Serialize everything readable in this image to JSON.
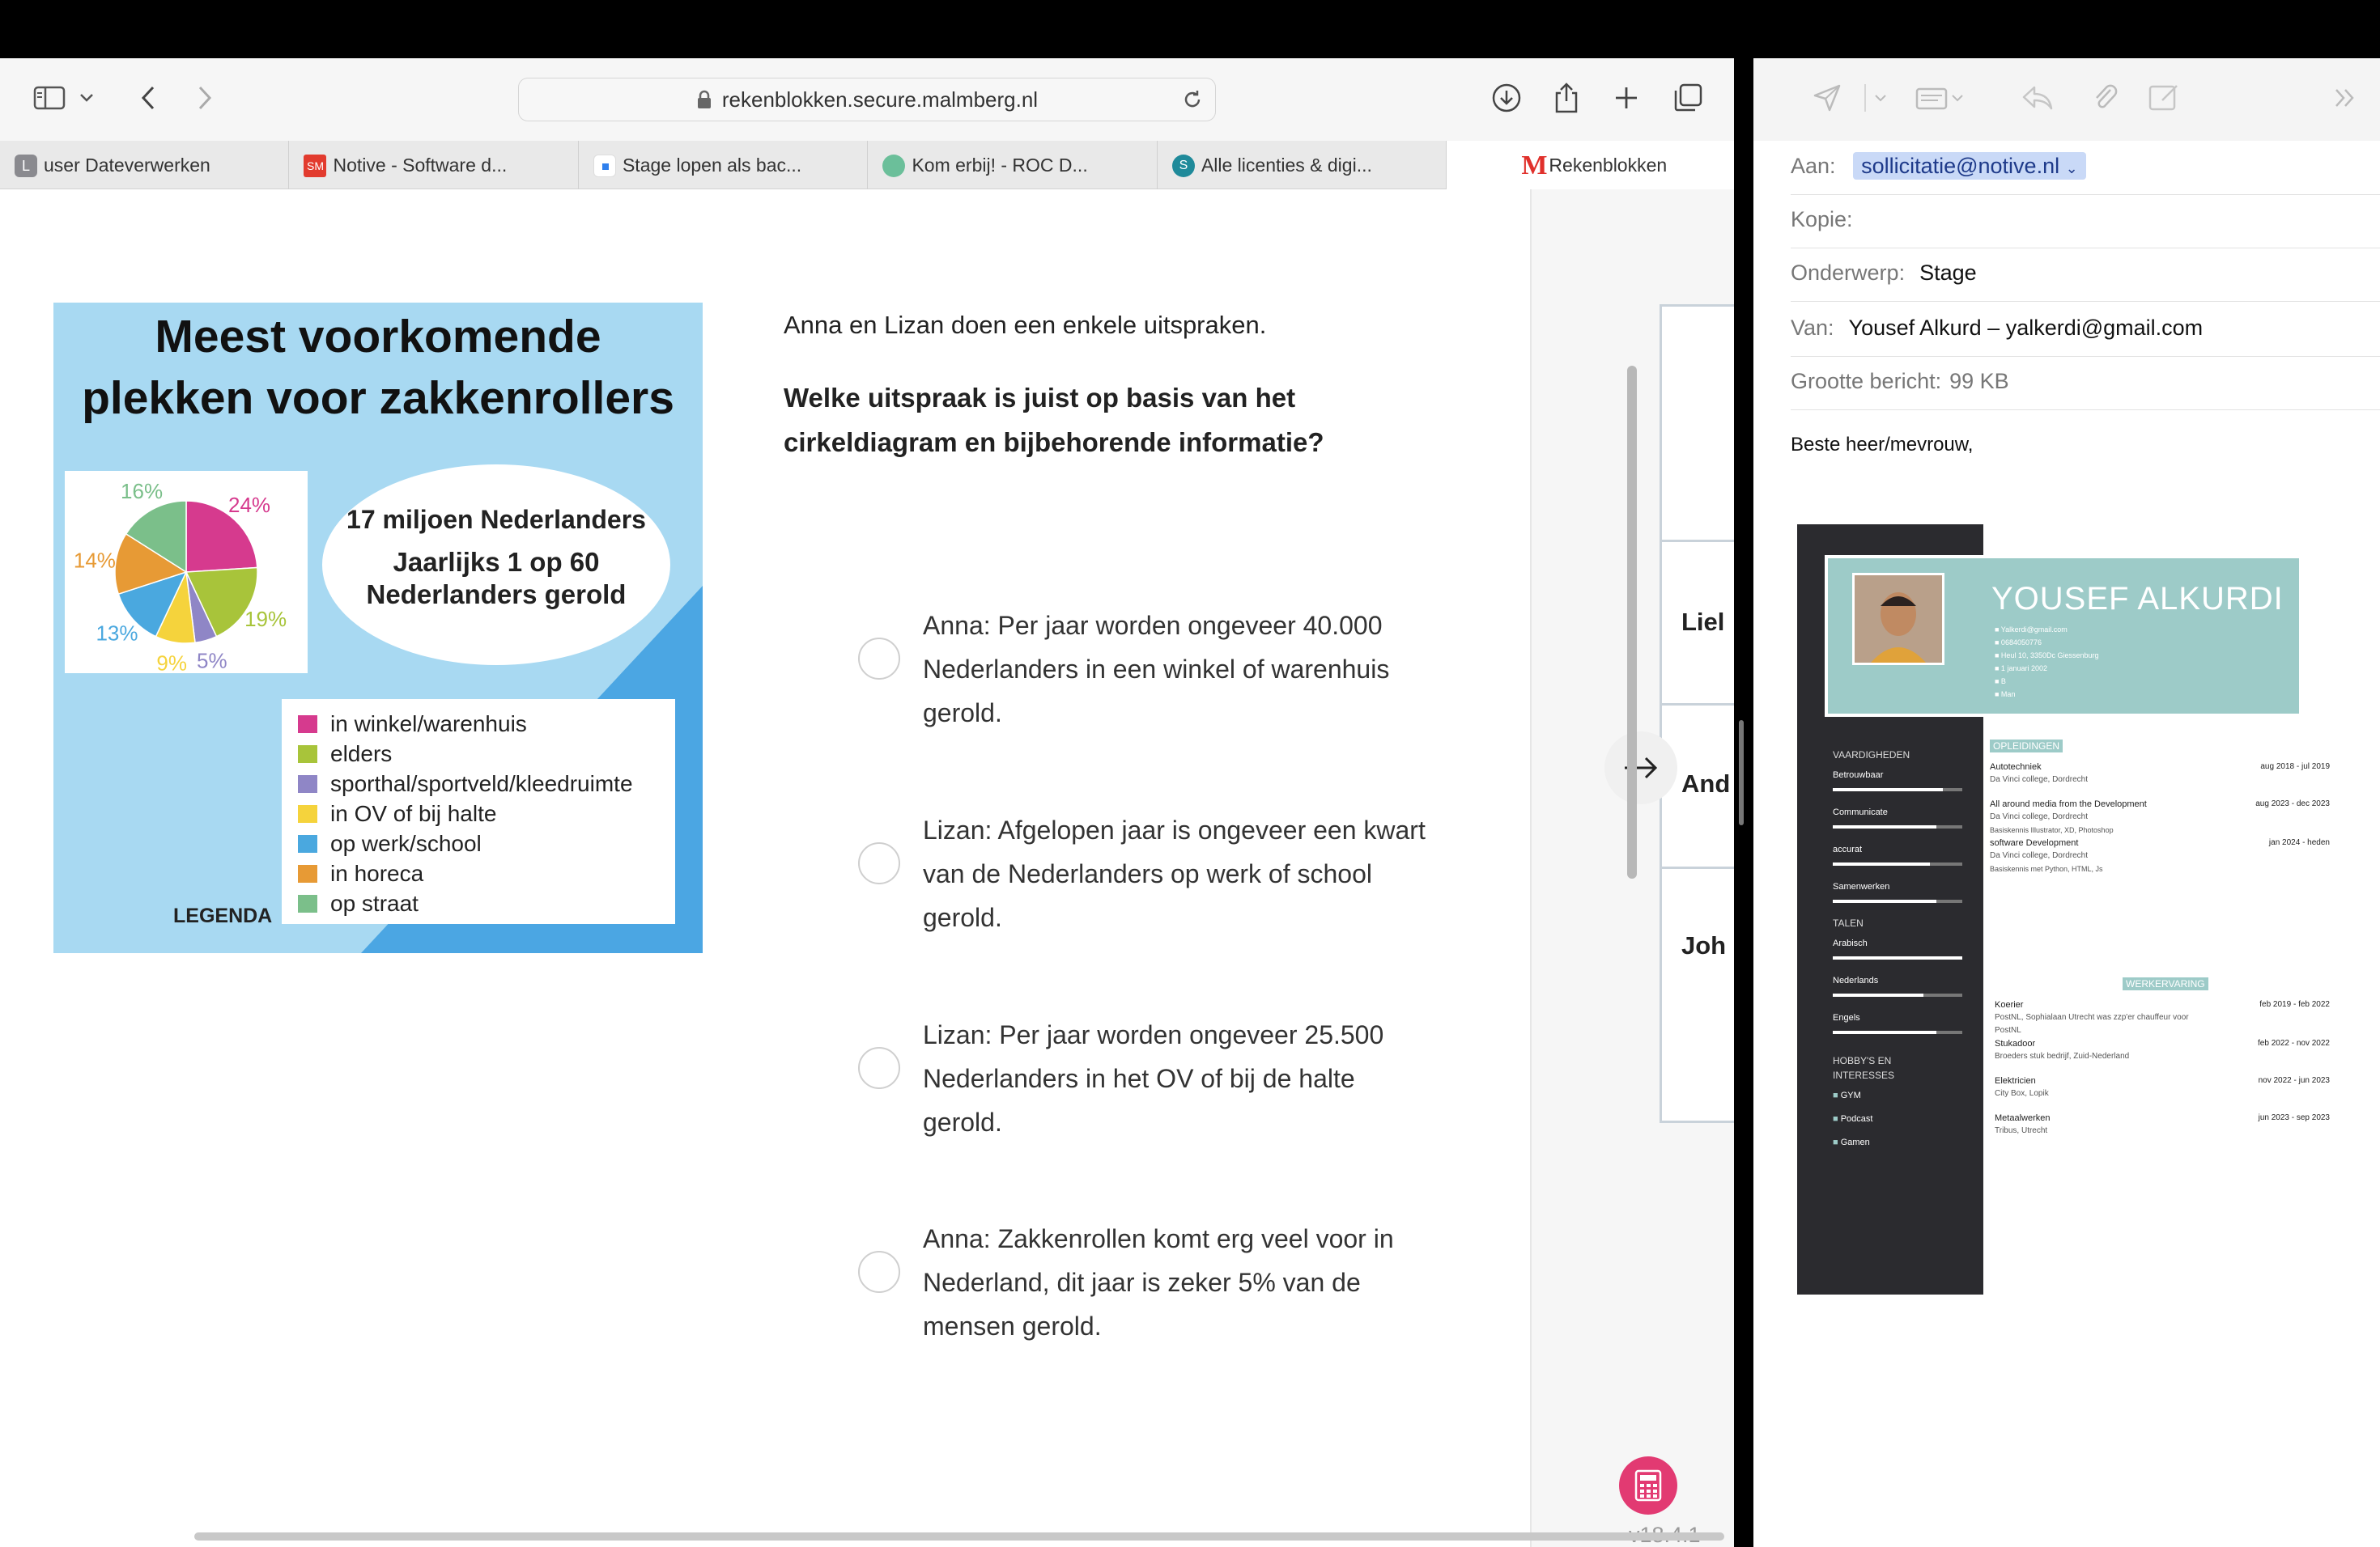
{
  "browser": {
    "url": "rekenblokken.secure.malmberg.nl",
    "tabs": [
      {
        "label": "user Dateverwerken",
        "favicon_color": "#8a8a8f",
        "favicon_text": "L"
      },
      {
        "label": "Notive - Software d...",
        "favicon_color": "#e23b2e",
        "favicon_text": "SM"
      },
      {
        "label": "Stage lopen als bac...",
        "favicon_color": "#2f80ed",
        "favicon_text": ""
      },
      {
        "label": "Kom erbij! - ROC D...",
        "favicon_color": "#6bbf9a",
        "favicon_text": ""
      },
      {
        "label": "Alle licenties & digi...",
        "favicon_color": "#1f8a9a",
        "favicon_text": "S"
      },
      {
        "label": "Rekenblokken",
        "favicon_color": "#e0302b",
        "favicon_text": "M",
        "active": true
      }
    ]
  },
  "exercise": {
    "intro": "Anna en Lizan doen een enkele uitspraken.",
    "question": "Welke uitspraak is juist op basis van het cirkeldiagram en bijbehorende informatie?",
    "options": [
      "Anna: Per jaar worden ongeveer 40.000 Nederlanders in een winkel of warenhuis gerold.",
      "Lizan: Afgelopen jaar is ongeveer een kwart van de Nederlanders op werk of school gerold.",
      "Lizan: Per jaar worden ongeveer 25.500 Nederlanders in het OV of bij de halte gerold.",
      "Anna: Zakkenrollen komt erg veel voor in Nederland, dit jaar is zeker 5% van de mensen gerold."
    ],
    "side_names": [
      "Liel",
      "And",
      "Joh"
    ],
    "version": "v18.4.1"
  },
  "infographic": {
    "title_line1": "Meest voorkomende",
    "title_line2": "plekken voor zakkenrollers",
    "oval_line1": "17 miljoen Nederlanders",
    "oval_line2": "Jaarlijks 1 op 60",
    "oval_line3": "Nederlanders gerold",
    "legend_title": "LEGENDA"
  },
  "chart_data": {
    "type": "pie",
    "title": "Meest voorkomende plekken voor zakkenrollers",
    "slices": [
      {
        "label": "in winkel/warenhuis",
        "value": 24,
        "pct_label": "24%",
        "color": "#d63a8e"
      },
      {
        "label": "elders",
        "value": 19,
        "pct_label": "19%",
        "color": "#a8c43a"
      },
      {
        "label": "sporthal/sportveld/kleedruimte",
        "value": 5,
        "pct_label": "5%",
        "color": "#8f86c6"
      },
      {
        "label": "in OV of bij halte",
        "value": 9,
        "pct_label": "9%",
        "color": "#f5d33c"
      },
      {
        "label": "op werk/school",
        "value": 13,
        "pct_label": "13%",
        "color": "#4aa8df"
      },
      {
        "label": "in horeca",
        "value": 14,
        "pct_label": "14%",
        "color": "#e79a35"
      },
      {
        "label": "op straat",
        "value": 16,
        "pct_label": "16%",
        "color": "#7bbf8a"
      }
    ],
    "legend_placement": "bottom-right"
  },
  "mail": {
    "to_label": "Aan:",
    "to_value": "sollicitatie@notive.nl",
    "cc_label": "Kopie:",
    "subject_label": "Onderwerp:",
    "subject_value": "Stage",
    "from_label": "Van:",
    "from_value": "Yousef Alkurd – yalkerdi@gmail.com",
    "size_label": "Grootte bericht:",
    "size_value": "99 KB",
    "greeting": "Beste heer/mevrouw,"
  },
  "cv": {
    "name": "YOUSEF  ALKURDI",
    "contact": [
      "Yalkerdi@gmail.com",
      "0684050776",
      "Heul 10, 3350Dc Giessenburg",
      "1 januari 2002",
      "B",
      "Man"
    ],
    "skills_title": "VAARDIGHEDEN",
    "skills": [
      {
        "label": "Betrouwbaar",
        "level": 0.85
      },
      {
        "label": "Communicate",
        "level": 0.8
      },
      {
        "label": "accurat",
        "level": 0.75
      },
      {
        "label": "Samenwerken",
        "level": 0.8
      }
    ],
    "languages_title": "TALEN",
    "languages": [
      {
        "label": "Arabisch",
        "level": 1.0
      },
      {
        "label": "Nederlands",
        "level": 0.7
      },
      {
        "label": "Engels",
        "level": 0.8
      }
    ],
    "hobbies_title": "HOBBY'S   EN INTERESSES",
    "hobbies": [
      "GYM",
      "Podcast",
      "Gamen"
    ],
    "education_title": "OPLEIDINGEN",
    "education": [
      {
        "title": "Autotechniek",
        "sub": "Da Vinci college, Dordrecht",
        "extra": "",
        "date": "aug 2018 - jul 2019"
      },
      {
        "title": "All around media from the Development",
        "sub": "Da Vinci college, Dordrecht",
        "extra": "Basiskennis Illustrator, XD, Photoshop",
        "date": "aug 2023 - dec 2023"
      },
      {
        "title": "software Development",
        "sub": "Da Vinci college, Dordrecht",
        "extra": "Basiskennis met Python, HTML, Js",
        "date": "jan 2024 - heden"
      }
    ],
    "work_title": "WERKERVARING",
    "work": [
      {
        "title": "Koerier",
        "sub": "PostNL, Sophialaan Utrecht was zzp'er chauffeur voor PostNL",
        "date": "feb 2019 - feb 2022"
      },
      {
        "title": "Stukadoor",
        "sub": "Broeders stuk bedrijf, Zuid-Nederland",
        "date": "feb 2022 - nov 2022"
      },
      {
        "title": "Elektricien",
        "sub": "City Box, Lopik",
        "date": "nov 2022 - jun 2023"
      },
      {
        "title": "Metaalwerken",
        "sub": "Tribus, Utrecht",
        "date": "jun 2023 - sep 2023"
      }
    ]
  }
}
